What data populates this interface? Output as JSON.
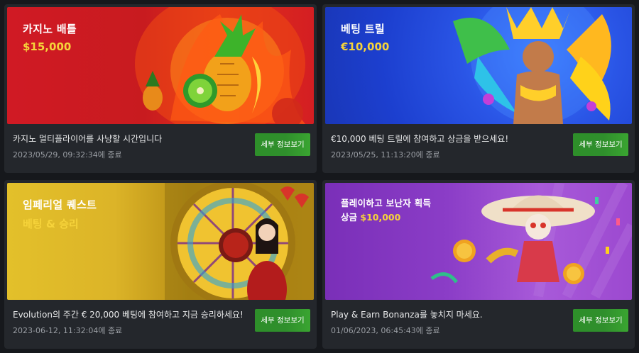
{
  "promotions": [
    {
      "banner_title": "카지노 배틀",
      "banner_subtitle": "$15,000",
      "description": "카지노 멀티플라이어를 사냥할 시간입니다",
      "date": "2023/05/29, 09:32:34에 종료",
      "button_label": "세부 정보보기"
    },
    {
      "banner_title": "베팅 트릴",
      "banner_subtitle": "€10,000",
      "description": "€10,000 베팅 트릴에 참여하고 상금을 받으세요!",
      "date": "2023/05/25, 11:13:20에 종료",
      "button_label": "세부 정보보기"
    },
    {
      "banner_title": "임페리얼 퀘스트",
      "banner_subtitle": "베팅 & 승리",
      "description": "Evolution의 주간 € 20,000 베팅에 참여하고 지금 승리하세요!",
      "date": "2023-06-12, 11:32:04에 종료",
      "button_label": "세부 정보보기"
    },
    {
      "banner_title": "플레이하고 보난자 획득",
      "banner_subtitle_prefix": "상금",
      "banner_subtitle": "$10,000",
      "description": "Play & Earn Bonanza를 놓치지 마세요.",
      "date": "01/06/2023, 06:45:43에 종료",
      "button_label": "세부 정보보기"
    }
  ],
  "colors": {
    "page_background": "#16181c",
    "card_background": "#24272c",
    "button_green": "#2f8f2c",
    "highlight_yellow": "#f6d33a"
  }
}
